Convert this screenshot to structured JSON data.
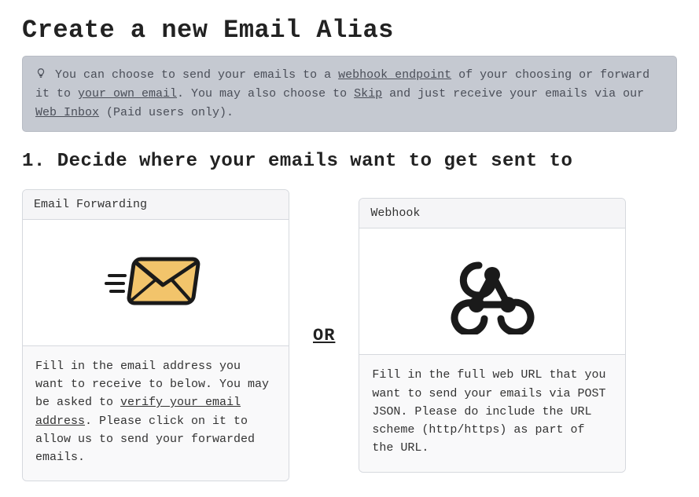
{
  "title": "Create a new Email Alias",
  "tip": {
    "t1": "You can choose to send your emails to a ",
    "link_webhook": "webhook endpoint",
    "t2": " of your choosing or forward it to ",
    "link_own_email": "your own email",
    "t3": ". You may also choose to ",
    "link_skip": "Skip",
    "t4": " and just receive your emails via our ",
    "link_web_inbox": "Web Inbox",
    "t5": " (Paid users only)."
  },
  "step1_heading": "1. Decide where your emails want to get sent to",
  "or_label": "OR",
  "card_forward": {
    "header": "Email Forwarding",
    "b1": "Fill in the email address you want to receive to below. You may be asked to ",
    "link_verify": "verify your email address",
    "b2": ". Please click on it to allow us to send your forwarded emails."
  },
  "card_webhook": {
    "header": "Webhook",
    "body": "Fill in the full web URL that you want to send your emails via POST JSON. Please do include the URL scheme (http/https) as part of the URL."
  }
}
